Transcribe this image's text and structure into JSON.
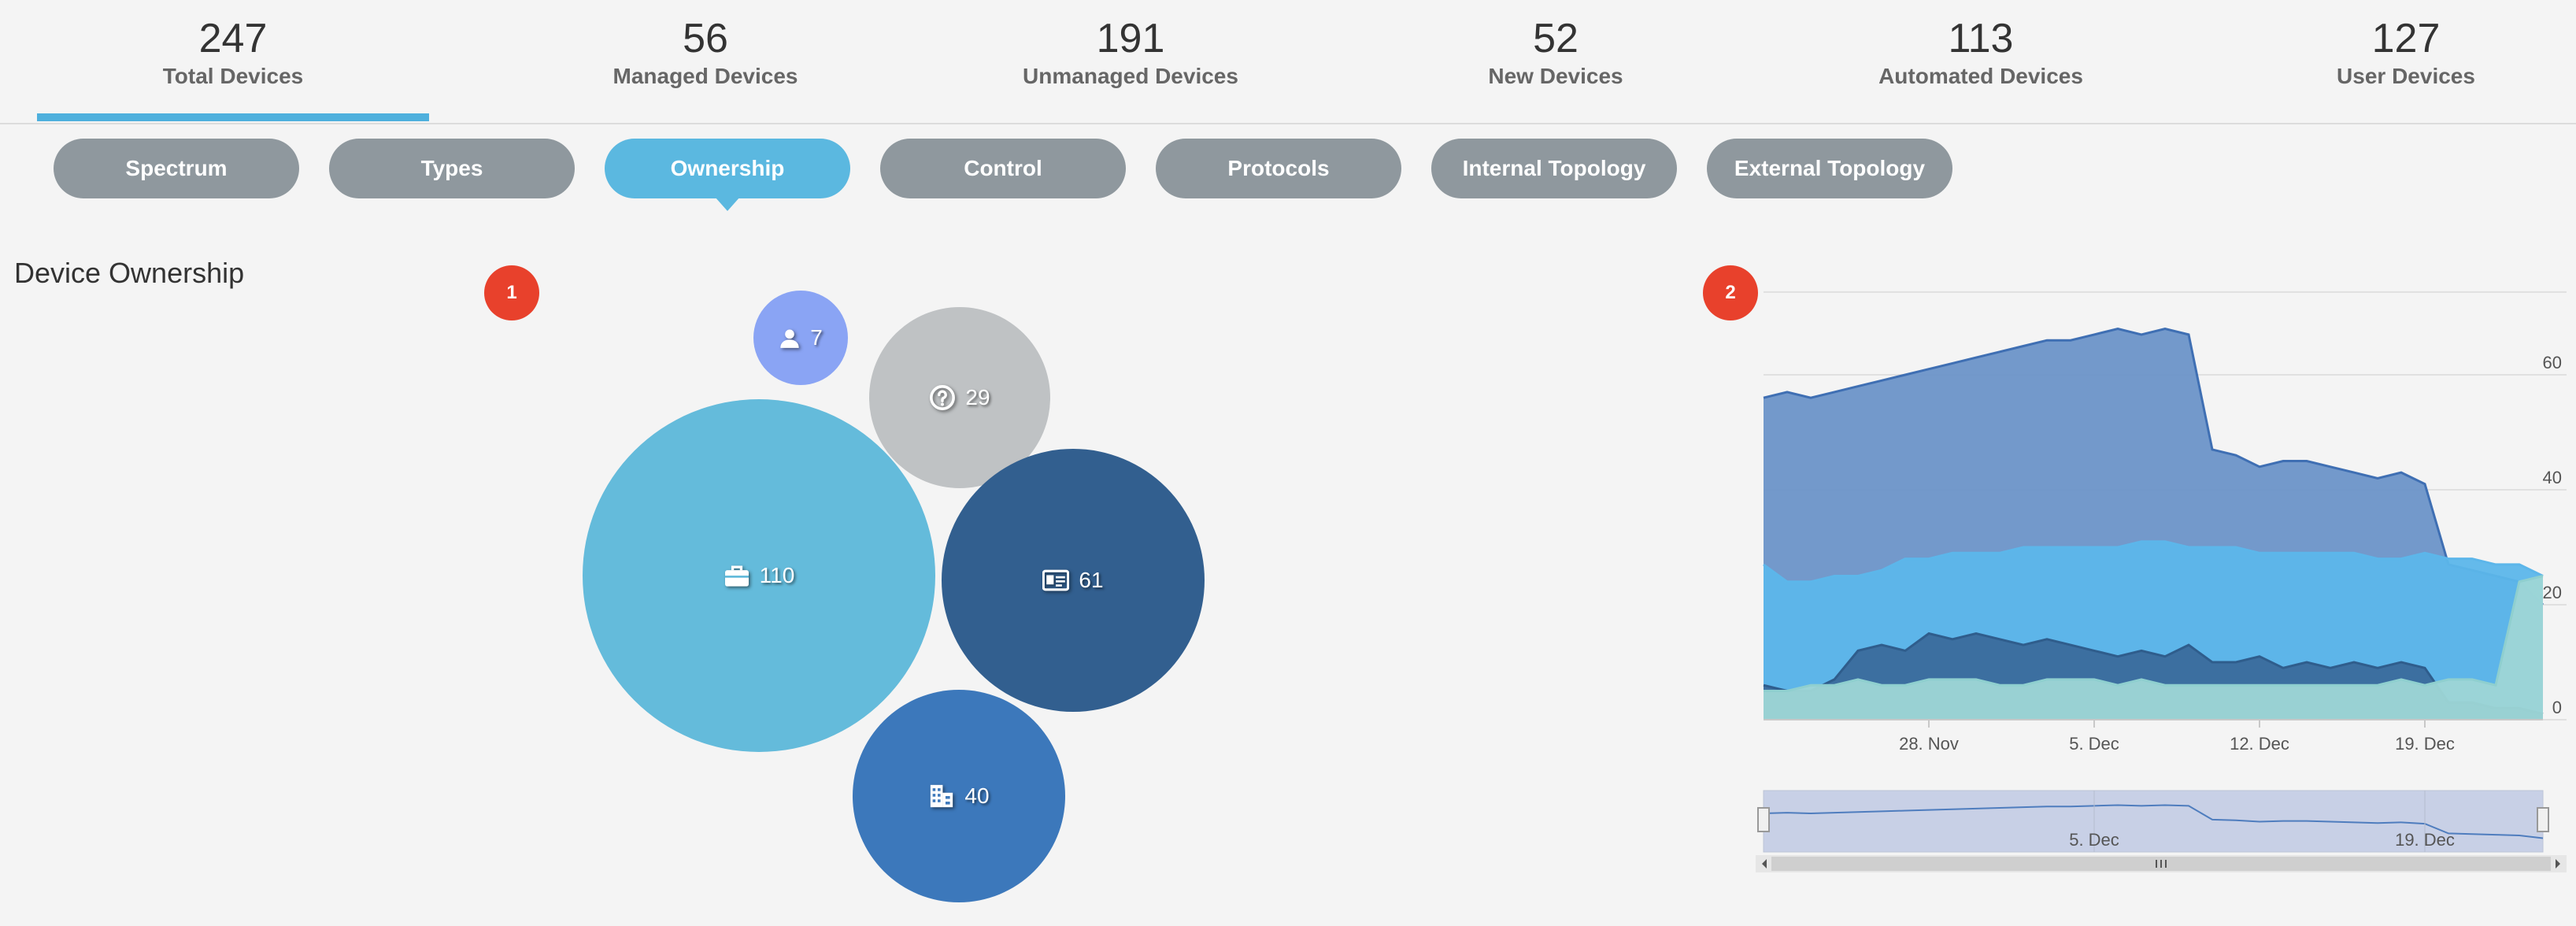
{
  "stats": [
    {
      "value": "247",
      "label": "Total Devices"
    },
    {
      "value": "56",
      "label": "Managed Devices"
    },
    {
      "value": "191",
      "label": "Unmanaged Devices"
    },
    {
      "value": "52",
      "label": "New Devices"
    },
    {
      "value": "113",
      "label": "Automated Devices"
    },
    {
      "value": "127",
      "label": "User Devices"
    }
  ],
  "active_stat": "Total Devices",
  "tabs": [
    "Spectrum",
    "Types",
    "Ownership",
    "Control",
    "Protocols",
    "Internal Topology",
    "External Topology"
  ],
  "active_tab": "Ownership",
  "section_title": "Device Ownership",
  "badges": {
    "bubble_panel": "1",
    "chart_panel": "2"
  },
  "bubbles": [
    {
      "icon": "user-icon",
      "value": "7",
      "color": "#8aa4f4"
    },
    {
      "icon": "question-circle-icon",
      "value": "29",
      "color": "#bfc2c4"
    },
    {
      "icon": "briefcase-icon",
      "value": "110",
      "color": "#64bbdb"
    },
    {
      "icon": "id-card-icon",
      "value": "61",
      "color": "#325f8f"
    },
    {
      "icon": "building-icon",
      "value": "40",
      "color": "#3c78bb"
    }
  ],
  "chart_data": {
    "type": "area",
    "stacking": "none",
    "x_tick_labels": [
      "28. Nov",
      "5. Dec",
      "12. Dec",
      "19. Dec"
    ],
    "y_tick_labels": [
      "0",
      "20",
      "40",
      "60"
    ],
    "ylim": [
      0,
      80
    ],
    "grid": true,
    "x_dates": [
      "21 Nov",
      "22 Nov",
      "23 Nov",
      "24 Nov",
      "25 Nov",
      "26 Nov",
      "27 Nov",
      "28 Nov",
      "29 Nov",
      "30 Nov",
      "1 Dec",
      "2 Dec",
      "3 Dec",
      "4 Dec",
      "5 Dec",
      "6 Dec",
      "7 Dec",
      "8 Dec",
      "9 Dec",
      "10 Dec",
      "11 Dec",
      "12 Dec",
      "13 Dec",
      "14 Dec",
      "15 Dec",
      "16 Dec",
      "17 Dec",
      "18 Dec",
      "19 Dec",
      "20 Dec",
      "21 Dec",
      "22 Dec",
      "23 Dec",
      "24 Dec"
    ],
    "series": [
      {
        "color": "#6b93c8",
        "line": "#3f6fb3",
        "values": [
          56,
          57,
          56,
          57,
          58,
          59,
          60,
          61,
          62,
          63,
          64,
          65,
          66,
          66,
          67,
          68,
          67,
          68,
          67,
          47,
          46,
          44,
          45,
          45,
          44,
          43,
          42,
          43,
          41,
          27,
          26,
          25,
          24,
          20
        ]
      },
      {
        "color": "#5cb6ea",
        "line": "#5cb6ea",
        "values": [
          27,
          24,
          24,
          25,
          25,
          26,
          28,
          28,
          29,
          29,
          29,
          30,
          30,
          30,
          30,
          30,
          31,
          31,
          30,
          30,
          30,
          29,
          29,
          29,
          29,
          29,
          28,
          28,
          29,
          28,
          28,
          27,
          27,
          25
        ]
      },
      {
        "color": "#3a6c9c",
        "line": "#2f5d8c",
        "values": [
          6,
          5,
          5,
          7,
          12,
          13,
          12,
          15,
          14,
          15,
          14,
          13,
          14,
          13,
          12,
          11,
          12,
          11,
          13,
          10,
          10,
          11,
          9,
          10,
          9,
          10,
          9,
          10,
          9,
          3,
          3,
          2,
          2,
          1
        ]
      },
      {
        "color": "#9ed6d6",
        "line": "#8fcfcf",
        "values": [
          5,
          5,
          6,
          6,
          7,
          6,
          6,
          7,
          7,
          7,
          6,
          6,
          7,
          7,
          7,
          6,
          7,
          6,
          6,
          6,
          6,
          6,
          6,
          6,
          6,
          6,
          6,
          7,
          6,
          7,
          7,
          6,
          24,
          25
        ]
      }
    ],
    "navigator": {
      "x_tick_labels": [
        "5. Dec",
        "19. Dec"
      ]
    }
  }
}
